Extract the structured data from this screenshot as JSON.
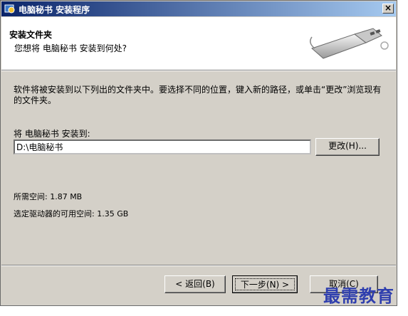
{
  "window": {
    "title": "电脑秘书  安装程序",
    "close_label": "×"
  },
  "header": {
    "title": "安装文件夹",
    "subtitle": "您想将 电脑秘书 安装到何处?"
  },
  "content": {
    "description": "软件将被安装到以下列出的文件夹中。要选择不同的位置，键入新的路径，或单击“更改”浏览现有的文件夹。",
    "destination_label": "将 电脑秘书 安装到:",
    "path_value": "D:\\电脑秘书",
    "change_button": "更改(H)...",
    "space_required": "所需空间: 1.87 MB",
    "space_available": "选定驱动器的可用空间: 1.35 GB"
  },
  "footer": {
    "back_button": "< 返回(B)",
    "next_button": "下一步(N) >",
    "cancel_button": "取消(C)"
  },
  "watermark": "最需教育",
  "colors": {
    "titlebar_start": "#0a246a",
    "titlebar_end": "#a6caf0",
    "dialog_bg": "#d4d0c8",
    "watermark": "#2f3fae"
  }
}
